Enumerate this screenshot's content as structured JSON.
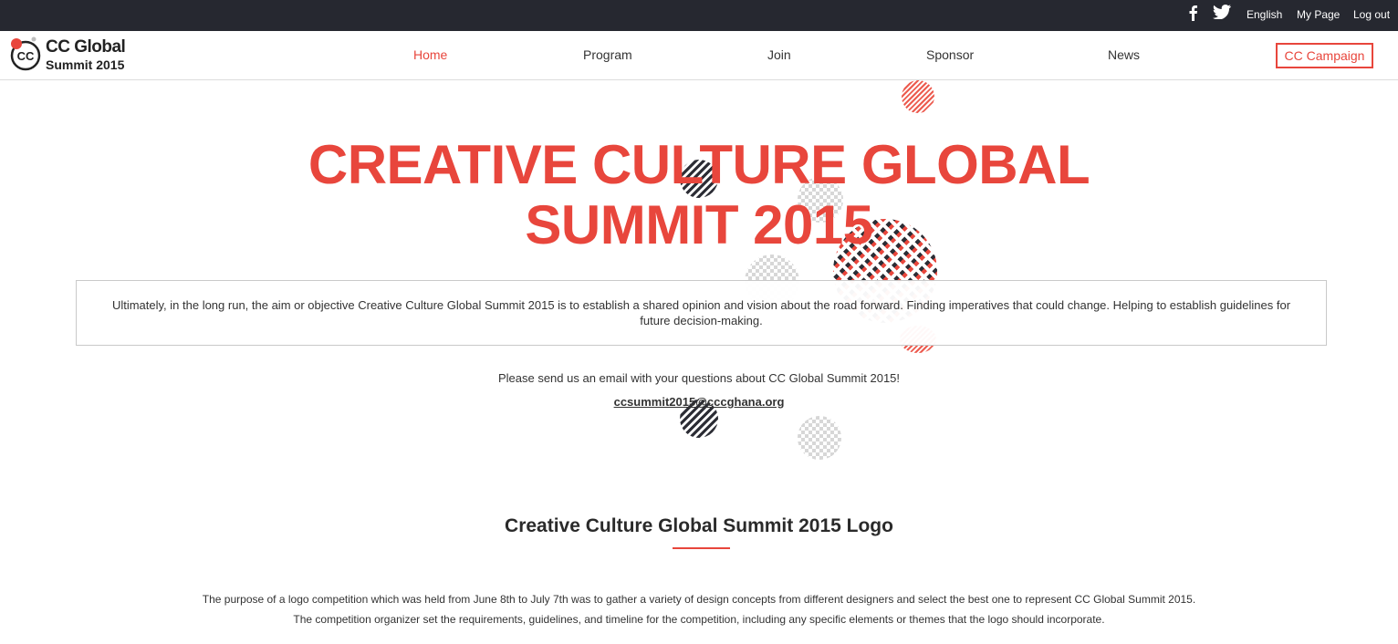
{
  "topbar": {
    "social": [
      "facebook-icon",
      "twitter-icon"
    ],
    "language": "English",
    "my_page": "My Page",
    "logout": "Log out"
  },
  "header": {
    "logo_line1": "CC Global",
    "logo_line2": "Summit 2015",
    "logo_mark": "CC",
    "nav": {
      "home": "Home",
      "program": "Program",
      "join": "Join",
      "sponsor": "Sponsor",
      "news": "News"
    },
    "campaign_button": "CC Campaign"
  },
  "hero": {
    "title_line1": "CREATIVE CULTURE GLOBAL",
    "title_line2": "SUMMIT 2015",
    "description": "Ultimately, in the long run, the aim or objective Creative Culture Global Summit 2015 is to establish a shared opinion and vision about the road forward. Finding imperatives that could change. Helping to establish guidelines for future decision-making.",
    "email_prompt": "Please send us an email with your questions about CC Global Summit 2015!",
    "email": "ccsummit2015@cccghana.org"
  },
  "logo_section": {
    "title": "Creative Culture Global Summit 2015 Logo",
    "line1": "The purpose of a logo competition which was held from June 8th to July 7th was to gather a variety of design concepts from different designers and select the best one to represent CC Global Summit 2015.",
    "line2": "The competition organizer set the requirements, guidelines, and timeline for the competition, including any specific elements or themes that the logo should incorporate."
  },
  "colors": {
    "accent": "#e8463c",
    "topbar_bg": "#262830",
    "text": "#333333"
  }
}
